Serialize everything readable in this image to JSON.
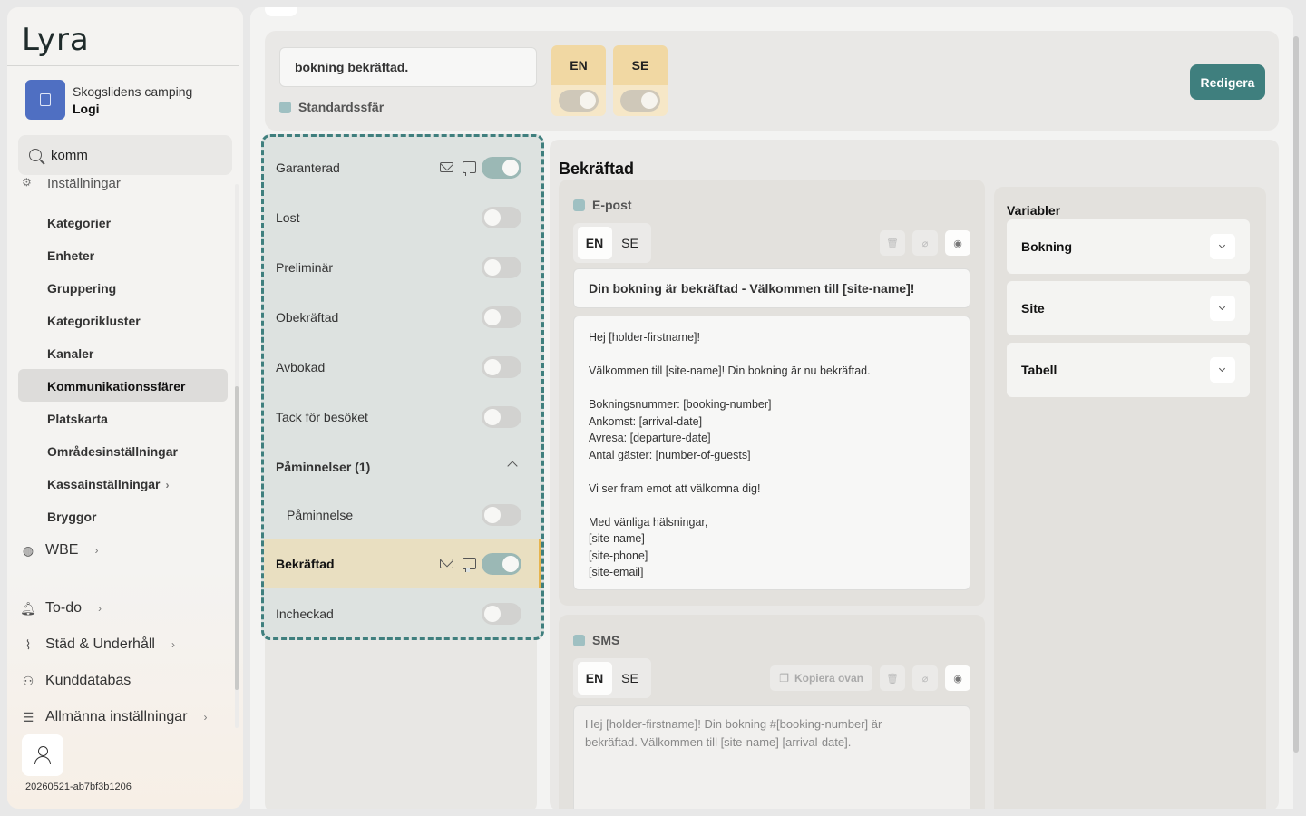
{
  "sidebar": {
    "logo": "Lyra",
    "site_name": "Skogslidens camping",
    "site_section": "Logi",
    "search_value": "komm",
    "partial_item": "Inställningar",
    "sub_items": [
      "Kategorier",
      "Enheter",
      "Gruppering",
      "Kategorikluster",
      "Kanaler",
      "Kommunikationssfärer",
      "Platskarta",
      "Områdesinställningar",
      "Kassainställningar",
      "Bryggor"
    ],
    "active_sub_item": "Kommunikationssfärer",
    "main_items": {
      "wbe": "WBE",
      "todo": "To-do",
      "clean": "Städ & Underhåll",
      "customers": "Kunddatabas",
      "general": "Allmänna inställningar"
    },
    "build_id": "20260521-ab7bf3b1206"
  },
  "header": {
    "name_value": "bokning bekräftad.",
    "standard_label": "Standardssfär",
    "lang_en": "EN",
    "lang_se": "SE",
    "edit_button": "Redigera"
  },
  "statuses": {
    "garanterad": "Garanterad",
    "lost": "Lost",
    "preliminar": "Preliminär",
    "obekraftad": "Obekräftad",
    "avbokad": "Avbokad",
    "tack": "Tack för besöket",
    "paminnelser": "Påminnelser (1)",
    "paminnelse": "Påminnelse",
    "bekraftad": "Bekräftad",
    "incheckad": "Incheckad"
  },
  "detail": {
    "title": "Bekräftad",
    "email_label": "E-post",
    "sms_label": "SMS",
    "tab_en": "EN",
    "tab_se": "SE",
    "copy_button": "Kopiera ovan",
    "subject": "Din bokning är bekräftad - Välkommen till [site-name]!",
    "body": {
      "l1": "Hej [holder-firstname]!",
      "l2": "Välkommen till [site-name]! Din bokning är nu bekräftad.",
      "l3": "Bokningsnummer: [booking-number]",
      "l4": "Ankomst: [arrival-date]",
      "l5": "Avresa: [departure-date]",
      "l6": "Antal gäster: [number-of-guests]",
      "l7": "Vi ser fram emot att välkomna dig!",
      "l8": "Med vänliga hälsningar,",
      "l9": "[site-name]",
      "l10": "[site-phone]",
      "l11": "[site-email]"
    },
    "sms_l1": "Hej [holder-firstname]! Din bokning #[booking-number] är",
    "sms_l2": "bekräftad. Välkommen till [site-name] [arrival-date]."
  },
  "variables": {
    "title": "Variabler",
    "items": [
      "Bokning",
      "Site",
      "Tabell"
    ]
  },
  "colors": {
    "accent": "#3f7f7e",
    "active_highlight": "#e9dfc1",
    "lang_header": "#f1d8a3"
  }
}
